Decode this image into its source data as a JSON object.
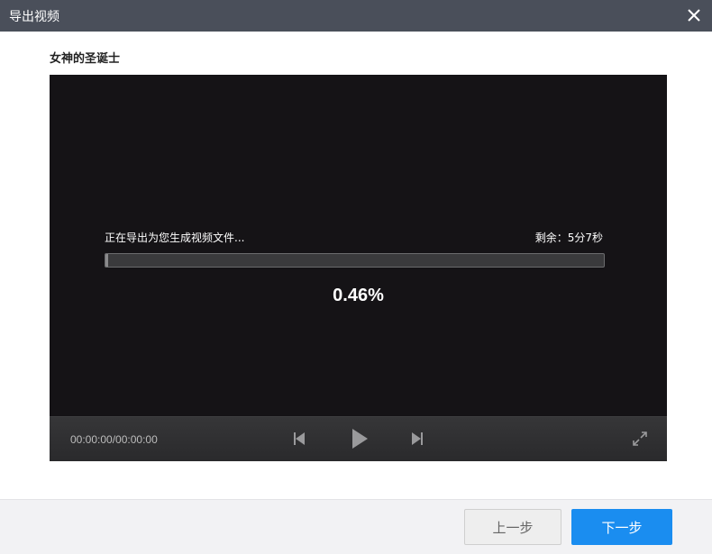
{
  "window": {
    "title": "导出视频",
    "close_icon": "close-icon"
  },
  "project": {
    "name": "女神的圣诞士"
  },
  "export": {
    "status_text": "正在导出为您生成视频文件...",
    "remaining": "剩余：5分7秒",
    "percent_text": "0.46%",
    "progress_fraction": 0.0046
  },
  "player": {
    "timecode": "00:00:00/00:00:00",
    "icons": {
      "prev": "skip-previous-icon",
      "play": "play-icon",
      "next": "skip-next-icon",
      "fullscreen": "fullscreen-icon"
    }
  },
  "footer": {
    "back_label": "上一步",
    "next_label": "下一步"
  },
  "colors": {
    "titlebar": "#4a4f5a",
    "player_bg": "#151316",
    "accent": "#1a8df0"
  }
}
